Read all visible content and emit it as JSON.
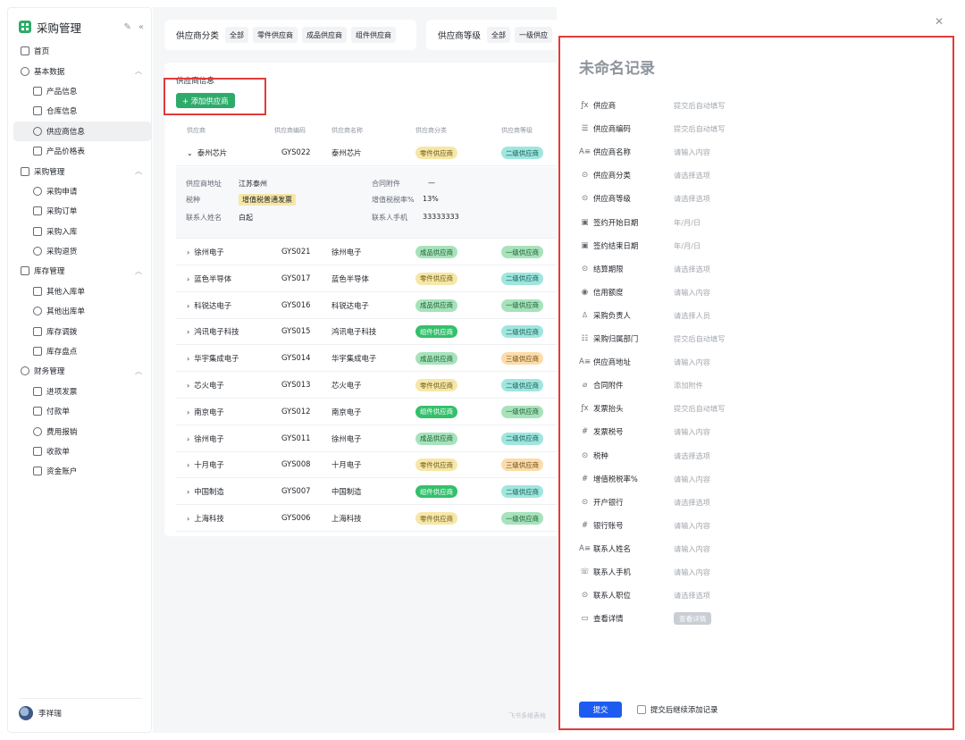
{
  "app": {
    "title": "采购管理"
  },
  "nav": [
    {
      "label": "首页",
      "level": 0,
      "icon": "home-icon"
    },
    {
      "label": "基本数据",
      "level": 0,
      "icon": "layers-icon",
      "expanded": true
    },
    {
      "label": "产品信息",
      "level": 1,
      "icon": "globe-icon"
    },
    {
      "label": "仓库信息",
      "level": 1,
      "icon": "warehouse-icon"
    },
    {
      "label": "供应商信息",
      "level": 1,
      "icon": "monitor-icon",
      "active": true
    },
    {
      "label": "产品价格表",
      "level": 1,
      "icon": "price-icon"
    },
    {
      "label": "采购管理",
      "level": 0,
      "icon": "list-icon",
      "expanded": true
    },
    {
      "label": "采购申请",
      "level": 1,
      "icon": "mail-icon"
    },
    {
      "label": "采购订单",
      "level": 1,
      "icon": "calendar-icon"
    },
    {
      "label": "采购入库",
      "level": 1,
      "icon": "inbound-icon"
    },
    {
      "label": "采购退货",
      "level": 1,
      "icon": "return-icon"
    },
    {
      "label": "库存管理",
      "level": 0,
      "icon": "clock-icon",
      "expanded": true
    },
    {
      "label": "其他入库单",
      "level": 1,
      "icon": "in-doc-icon"
    },
    {
      "label": "其他出库单",
      "level": 1,
      "icon": "out-doc-icon"
    },
    {
      "label": "库存调拨",
      "level": 1,
      "icon": "transfer-icon"
    },
    {
      "label": "库存盘点",
      "level": 1,
      "icon": "inventory-icon"
    },
    {
      "label": "财务管理",
      "level": 0,
      "icon": "finance-icon",
      "expanded": true
    },
    {
      "label": "进项发票",
      "level": 1,
      "icon": "invoice-icon"
    },
    {
      "label": "付款单",
      "level": 1,
      "icon": "payment-icon"
    },
    {
      "label": "费用报销",
      "level": 1,
      "icon": "expense-icon"
    },
    {
      "label": "收款单",
      "level": 1,
      "icon": "receipt-icon"
    },
    {
      "label": "资金账户",
      "level": 1,
      "icon": "chart-icon"
    }
  ],
  "user": {
    "name": "李祥瑞"
  },
  "filters": {
    "category_label": "供应商分类",
    "category_chips": [
      "全部",
      "零件供应商",
      "成品供应商",
      "组件供应商"
    ],
    "level_label": "供应商等级",
    "level_chips": [
      "全部",
      "一级供应"
    ]
  },
  "table": {
    "title": "供应商信息",
    "add_button": "+ 添加供应商",
    "headers": [
      "供应商",
      "供应商编码",
      "供应商名称",
      "供应商分类",
      "供应商等级"
    ],
    "expanded_row": {
      "supplier": "泰州芯片",
      "code": "GYS022",
      "name": "泰州芯片",
      "category": "零件供应商",
      "level": "二级供应商",
      "details": {
        "addr_label": "供应商地址",
        "addr": "江苏泰州",
        "tax_label": "税种",
        "tax": "增值税普通发票",
        "contact_label": "联系人姓名",
        "contact": "白起",
        "attach_label": "合同附件",
        "attach": "—",
        "rate_label": "增值税税率%",
        "rate": "13%",
        "phone_label": "联系人手机",
        "phone": "33333333"
      }
    },
    "rows": [
      {
        "supplier": "徐州电子",
        "code": "GYS021",
        "name": "徐州电子",
        "category": "成品供应商",
        "level": "一级供应商"
      },
      {
        "supplier": "蓝色半导体",
        "code": "GYS017",
        "name": "蓝色半导体",
        "category": "零件供应商",
        "level": "二级供应商"
      },
      {
        "supplier": "科锐达电子",
        "code": "GYS016",
        "name": "科锐达电子",
        "category": "成品供应商",
        "level": "一级供应商"
      },
      {
        "supplier": "鸿讯电子科技",
        "code": "GYS015",
        "name": "鸿讯电子科技",
        "category": "组件供应商",
        "level": "二级供应商"
      },
      {
        "supplier": "华宇集成电子",
        "code": "GYS014",
        "name": "华宇集成电子",
        "category": "成品供应商",
        "level": "三级供应商"
      },
      {
        "supplier": "芯火电子",
        "code": "GYS013",
        "name": "芯火电子",
        "category": "零件供应商",
        "level": "二级供应商"
      },
      {
        "supplier": "南京电子",
        "code": "GYS012",
        "name": "南京电子",
        "category": "组件供应商",
        "level": "一级供应商"
      },
      {
        "supplier": "徐州电子",
        "code": "GYS011",
        "name": "徐州电子",
        "category": "成品供应商",
        "level": "二级供应商"
      },
      {
        "supplier": "十月电子",
        "code": "GYS008",
        "name": "十月电子",
        "category": "零件供应商",
        "level": "三级供应商"
      },
      {
        "supplier": "中国制造",
        "code": "GYS007",
        "name": "中国制造",
        "category": "组件供应商",
        "level": "二级供应商"
      },
      {
        "supplier": "上海科技",
        "code": "GYS006",
        "name": "上海科技",
        "category": "零件供应商",
        "level": "一级供应商"
      }
    ]
  },
  "tag_colors": {
    "零件供应商": "#f6e7a8",
    "成品供应商": "#a6e3bb",
    "组件供应商": "#34c06b",
    "一级供应商": "#a6e3bb",
    "二级供应商": "#9fe6df",
    "三级供应商": "#fbdcaa"
  },
  "watermark": "飞书多维表格",
  "drawer": {
    "title": "未命名记录",
    "fields": [
      {
        "icon": "formula-icon",
        "glyph": "ƒx",
        "label": "供应商",
        "value": "提交后自动填写"
      },
      {
        "icon": "auto-number-icon",
        "glyph": "☰",
        "label": "供应商编码",
        "value": "提交后自动填写"
      },
      {
        "icon": "text-icon",
        "glyph": "A≡",
        "label": "供应商名称",
        "value": "请输入内容"
      },
      {
        "icon": "single-select-icon",
        "glyph": "⊙",
        "label": "供应商分类",
        "value": "请选择选项"
      },
      {
        "icon": "single-select-icon",
        "glyph": "⊙",
        "label": "供应商等级",
        "value": "请选择选项"
      },
      {
        "icon": "date-icon",
        "glyph": "▣",
        "label": "签约开始日期",
        "value": "年/月/日"
      },
      {
        "icon": "date-icon",
        "glyph": "▣",
        "label": "签约结束日期",
        "value": "年/月/日"
      },
      {
        "icon": "single-select-icon",
        "glyph": "⊙",
        "label": "结算期限",
        "value": "请选择选项"
      },
      {
        "icon": "currency-icon",
        "glyph": "◉",
        "label": "信用额度",
        "value": "请输入内容"
      },
      {
        "icon": "person-icon",
        "glyph": "♙",
        "label": "采购负责人",
        "value": "请选择人员"
      },
      {
        "icon": "lookup-icon",
        "glyph": "☷",
        "label": "采购归属部门",
        "value": "提交后自动填写"
      },
      {
        "icon": "text-icon",
        "glyph": "A≡",
        "label": "供应商地址",
        "value": "请输入内容"
      },
      {
        "icon": "attachment-icon",
        "glyph": "⌀",
        "label": "合同附件",
        "value": "添加附件"
      },
      {
        "icon": "formula-icon",
        "glyph": "ƒx",
        "label": "发票抬头",
        "value": "提交后自动填写"
      },
      {
        "icon": "number-icon",
        "glyph": "#",
        "label": "发票税号",
        "value": "请输入内容"
      },
      {
        "icon": "single-select-icon",
        "glyph": "⊙",
        "label": "税种",
        "value": "请选择选项"
      },
      {
        "icon": "number-icon",
        "glyph": "#",
        "label": "增值税税率%",
        "value": "请输入内容"
      },
      {
        "icon": "single-select-icon",
        "glyph": "⊙",
        "label": "开户银行",
        "value": "请选择选项"
      },
      {
        "icon": "number-icon",
        "glyph": "#",
        "label": "银行账号",
        "value": "请输入内容"
      },
      {
        "icon": "text-icon",
        "glyph": "A≡",
        "label": "联系人姓名",
        "value": "请输入内容"
      },
      {
        "icon": "phone-icon",
        "glyph": "☏",
        "label": "联系人手机",
        "value": "请输入内容"
      },
      {
        "icon": "single-select-icon",
        "glyph": "⊙",
        "label": "联系人职位",
        "value": "请选择选项"
      },
      {
        "icon": "button-field-icon",
        "glyph": "▭",
        "label": "查看详情",
        "button": "查看详情"
      }
    ],
    "submit": "提交",
    "continue_label": "提交后继续添加记录"
  }
}
